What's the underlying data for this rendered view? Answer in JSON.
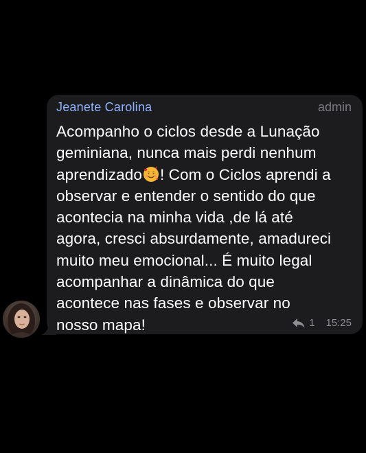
{
  "message": {
    "sender_name": "Jeanete Carolina",
    "role": "admin",
    "text_part1": "Acompanho o ciclos desde a Lunação\ngeminiana, nunca mais perdi nenhum\naprendizado",
    "emoji_name": "smiling-face-with-hearts-emoji",
    "text_part2": "! Com o Ciclos aprendi a\nobservar e entender o sentido do que\nacontecia na minha vida ,de lá até\nagora, cresci absurdamente, amadureci\nmuito meu emocional... É muito legal\nacompanhar a dinâmica do que\nacontece nas fases e observar no\nnosso mapa!",
    "reply_count": "1",
    "time": "15:25"
  },
  "colors": {
    "background": "#000000",
    "bubble": "#1c1c1e",
    "sender_name": "#8fb3ff",
    "meta": "#8e8e93"
  },
  "icons": {
    "reply": "reply-arrow-icon",
    "avatar": "profile-photo"
  }
}
